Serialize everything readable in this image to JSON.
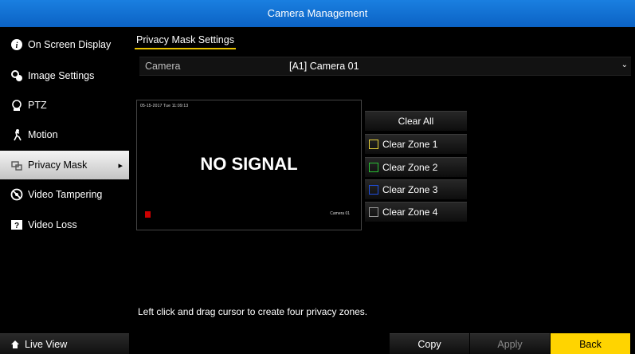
{
  "window": {
    "title": "Camera Management"
  },
  "sidebar": {
    "items": [
      {
        "label": "On Screen Display",
        "icon": "info-icon"
      },
      {
        "label": "Image Settings",
        "icon": "image-settings-icon"
      },
      {
        "label": "PTZ",
        "icon": "ptz-icon"
      },
      {
        "label": "Motion",
        "icon": "motion-icon"
      },
      {
        "label": "Privacy Mask",
        "icon": "privacy-mask-icon",
        "active": true
      },
      {
        "label": "Video Tampering",
        "icon": "video-tampering-icon"
      },
      {
        "label": "Video Loss",
        "icon": "video-loss-icon"
      }
    ],
    "live_view": "Live View"
  },
  "tab": {
    "label": "Privacy Mask Settings"
  },
  "camera": {
    "label": "Camera",
    "value": "[A1] Camera 01"
  },
  "preview": {
    "timestamp": "05-15-2017 Tue 11:09:13",
    "message": "NO SIGNAL",
    "camera_name": "Camera 01",
    "rec_color": "#cc0000"
  },
  "zones": {
    "clear_all": "Clear All",
    "items": [
      {
        "label": "Clear Zone 1",
        "color": "#e8d23a"
      },
      {
        "label": "Clear Zone 2",
        "color": "#29c233"
      },
      {
        "label": "Clear Zone 3",
        "color": "#1f4fe0"
      },
      {
        "label": "Clear Zone 4",
        "color": "#9a9a9a"
      }
    ]
  },
  "hint": "Left click and drag cursor to create four privacy zones.",
  "footer": {
    "copy": "Copy",
    "apply": "Apply",
    "back": "Back"
  },
  "colors": {
    "title_bar": "#0f6fd6",
    "accent": "#ffd400"
  }
}
